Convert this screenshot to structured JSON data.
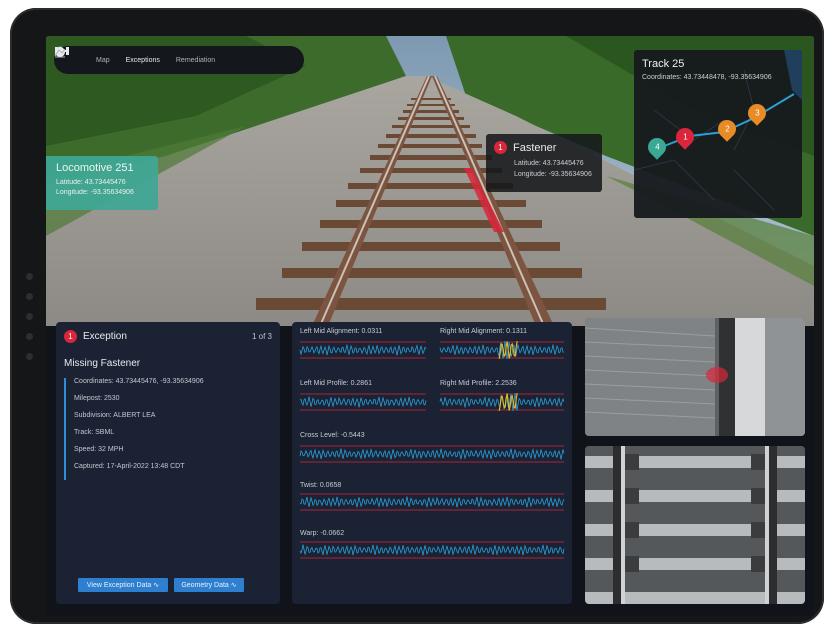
{
  "nav": {
    "items": [
      {
        "label": "Map",
        "icon": "map-pin-icon"
      },
      {
        "label": "Exceptions",
        "icon": "exceptions-icon"
      },
      {
        "label": "Remediation",
        "icon": "remediation-icon"
      }
    ],
    "active": "Exceptions"
  },
  "locomotive": {
    "title": "Locomotive 251",
    "latitude": "Latitude: 43.73445476",
    "longitude": "Longitude: -93.35634906"
  },
  "fastener": {
    "badge": "1",
    "title": "Fastener",
    "latitude": "Latitude: 43.73445476",
    "longitude": "Longitude: -93.35634906"
  },
  "track_map": {
    "title": "Track 25",
    "coordinates": "Coordinates: 43.73448478, -93.35634906",
    "pins": [
      {
        "label": "4",
        "color": "#3aa893"
      },
      {
        "label": "1",
        "color": "#d9263a"
      },
      {
        "label": "2",
        "color": "#e88b25"
      },
      {
        "label": "3",
        "color": "#e88b25"
      }
    ]
  },
  "exception": {
    "badge": "1",
    "title": "Exception",
    "pager": "1 of 3",
    "subtitle": "Missing Fastener",
    "details": [
      "Coordinates: 43.73445476, -93.35634906",
      "Milepost: 2530",
      "Subdivision: ALBERT LEA",
      "Track: SBML",
      "Speed: 32 MPH",
      "Captured: 17-April-2022 13:48 CDT"
    ],
    "buttons": [
      "View Exception Data",
      "Geometry Data"
    ]
  },
  "geometry": {
    "channels": [
      {
        "label": "Left Mid Alignment: 0.0311"
      },
      {
        "label": "Right Mid Alignment: 0.1311"
      },
      {
        "label": "Left Mid Profile: 0.2861"
      },
      {
        "label": "Right Mid Profile: 2.2536"
      },
      {
        "label": "Cross Level: -0.5443"
      },
      {
        "label": "Twist: 0.0658"
      },
      {
        "label": "Warp: -0.0662"
      }
    ]
  },
  "colors": {
    "accent": "#2e7fd0",
    "alert": "#d9263a",
    "locomotive": "#3fa896",
    "panel": "#1a2234",
    "signal": "#2b9fd6",
    "threshold": "#d9263a"
  }
}
